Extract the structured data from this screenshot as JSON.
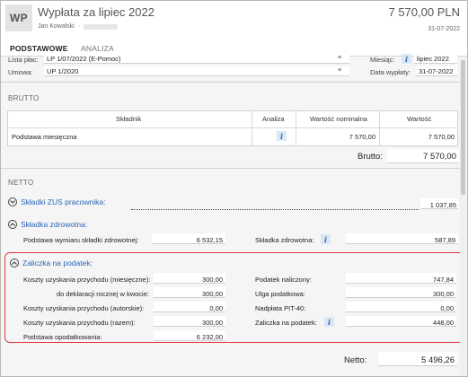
{
  "header": {
    "initials": "WP",
    "title": "Wypłata za lipiec 2022",
    "person": "Jan Kowalski",
    "separator": "·",
    "amount": "7 570,00 PLN",
    "date": "31-07-2022"
  },
  "tabs": [
    {
      "label": "PODSTAWOWE",
      "active": true
    },
    {
      "label": "ANALIZA",
      "active": false
    }
  ],
  "info": {
    "lista_label": "Lista płac:",
    "lista_value": "LP 1/07/2022 (E-Pomoc)",
    "umowa_label": "Umowa:",
    "umowa_value": "UP 1/2020",
    "miesiac_label": "Miesiąc:",
    "miesiac_value": "lipiec 2022",
    "data_wyplaty_label": "Data wypłaty:",
    "data_wyplaty_value": "31-07-2022",
    "menu_glyph": "≡"
  },
  "brutto": {
    "section_title": "BRUTTO",
    "columns": [
      "Składnik",
      "Analiza",
      "Wartość nominalna",
      "Wartość"
    ],
    "rows": [
      {
        "skladnik": "Podstawa miesięczna",
        "nominal": "7 570,00",
        "value": "7 570,00"
      }
    ],
    "total_label": "Brutto:",
    "total_value": "7 570,00"
  },
  "netto": {
    "section_title": "NETTO",
    "zus_label": "Składki ZUS pracownika:",
    "zus_value": "1 037,85",
    "zdrowotna_label": "Składka zdrowotna:",
    "podstawa_zdrowotnej_label": "Podstawa wymiaru składki zdrowotnej:",
    "podstawa_zdrowotnej_value": "6 532,15",
    "skladka_zdrowotna_label": "Składka zdrowotna:",
    "skladka_zdrowotna_value": "587,89",
    "zaliczka_label": "Zaliczka na podatek:",
    "left_rows": [
      {
        "label": "Koszty uzyskania przychodu (miesięczne):",
        "value": "300,00"
      },
      {
        "label": "do deklaracji rocznej w kwocie:",
        "value": "300,00"
      },
      {
        "label": "Koszty uzyskania przychodu (autorskie):",
        "value": "0,00"
      },
      {
        "label": "Koszty uzyskania przychodu (razem):",
        "value": "300,00"
      },
      {
        "label": "Podstawa opodatkowania:",
        "value": "6 232,00"
      }
    ],
    "right_rows": [
      {
        "label": "Podatek naliczony:",
        "value": "747,84"
      },
      {
        "label": "Ulga podatkowa:",
        "value": "300,00"
      },
      {
        "label": "Nadpłata PIT-40:",
        "value": "0,00"
      },
      {
        "label": "Zaliczka na podatek:",
        "value": "448,00"
      }
    ],
    "total_label": "Netto:",
    "total_value": "5 496,26"
  },
  "icons": {
    "info": "i",
    "collapse": "⌃"
  },
  "colors": {
    "link": "#2a66b3",
    "highlight": "#e0393e",
    "tab_accent": "#3a78c0"
  }
}
